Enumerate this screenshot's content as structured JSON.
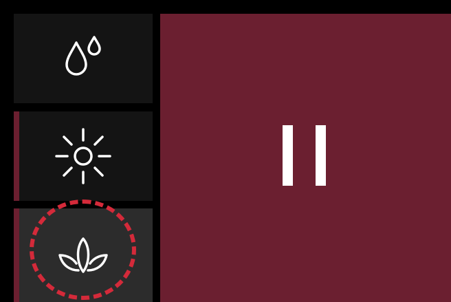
{
  "sidebar": {
    "items": [
      {
        "icon": "water-drops-icon",
        "selected": false
      },
      {
        "icon": "sun-icon",
        "selected": false
      },
      {
        "icon": "lotus-icon",
        "selected": true
      }
    ]
  },
  "main": {
    "icon": "pause-icon"
  },
  "colors": {
    "background": "#000000",
    "button_bg": "#141414",
    "button_selected_bg": "#2c2c2c",
    "accent": "#6b1f30",
    "icon": "#ffffff",
    "highlight_ring": "#d42a3a"
  }
}
